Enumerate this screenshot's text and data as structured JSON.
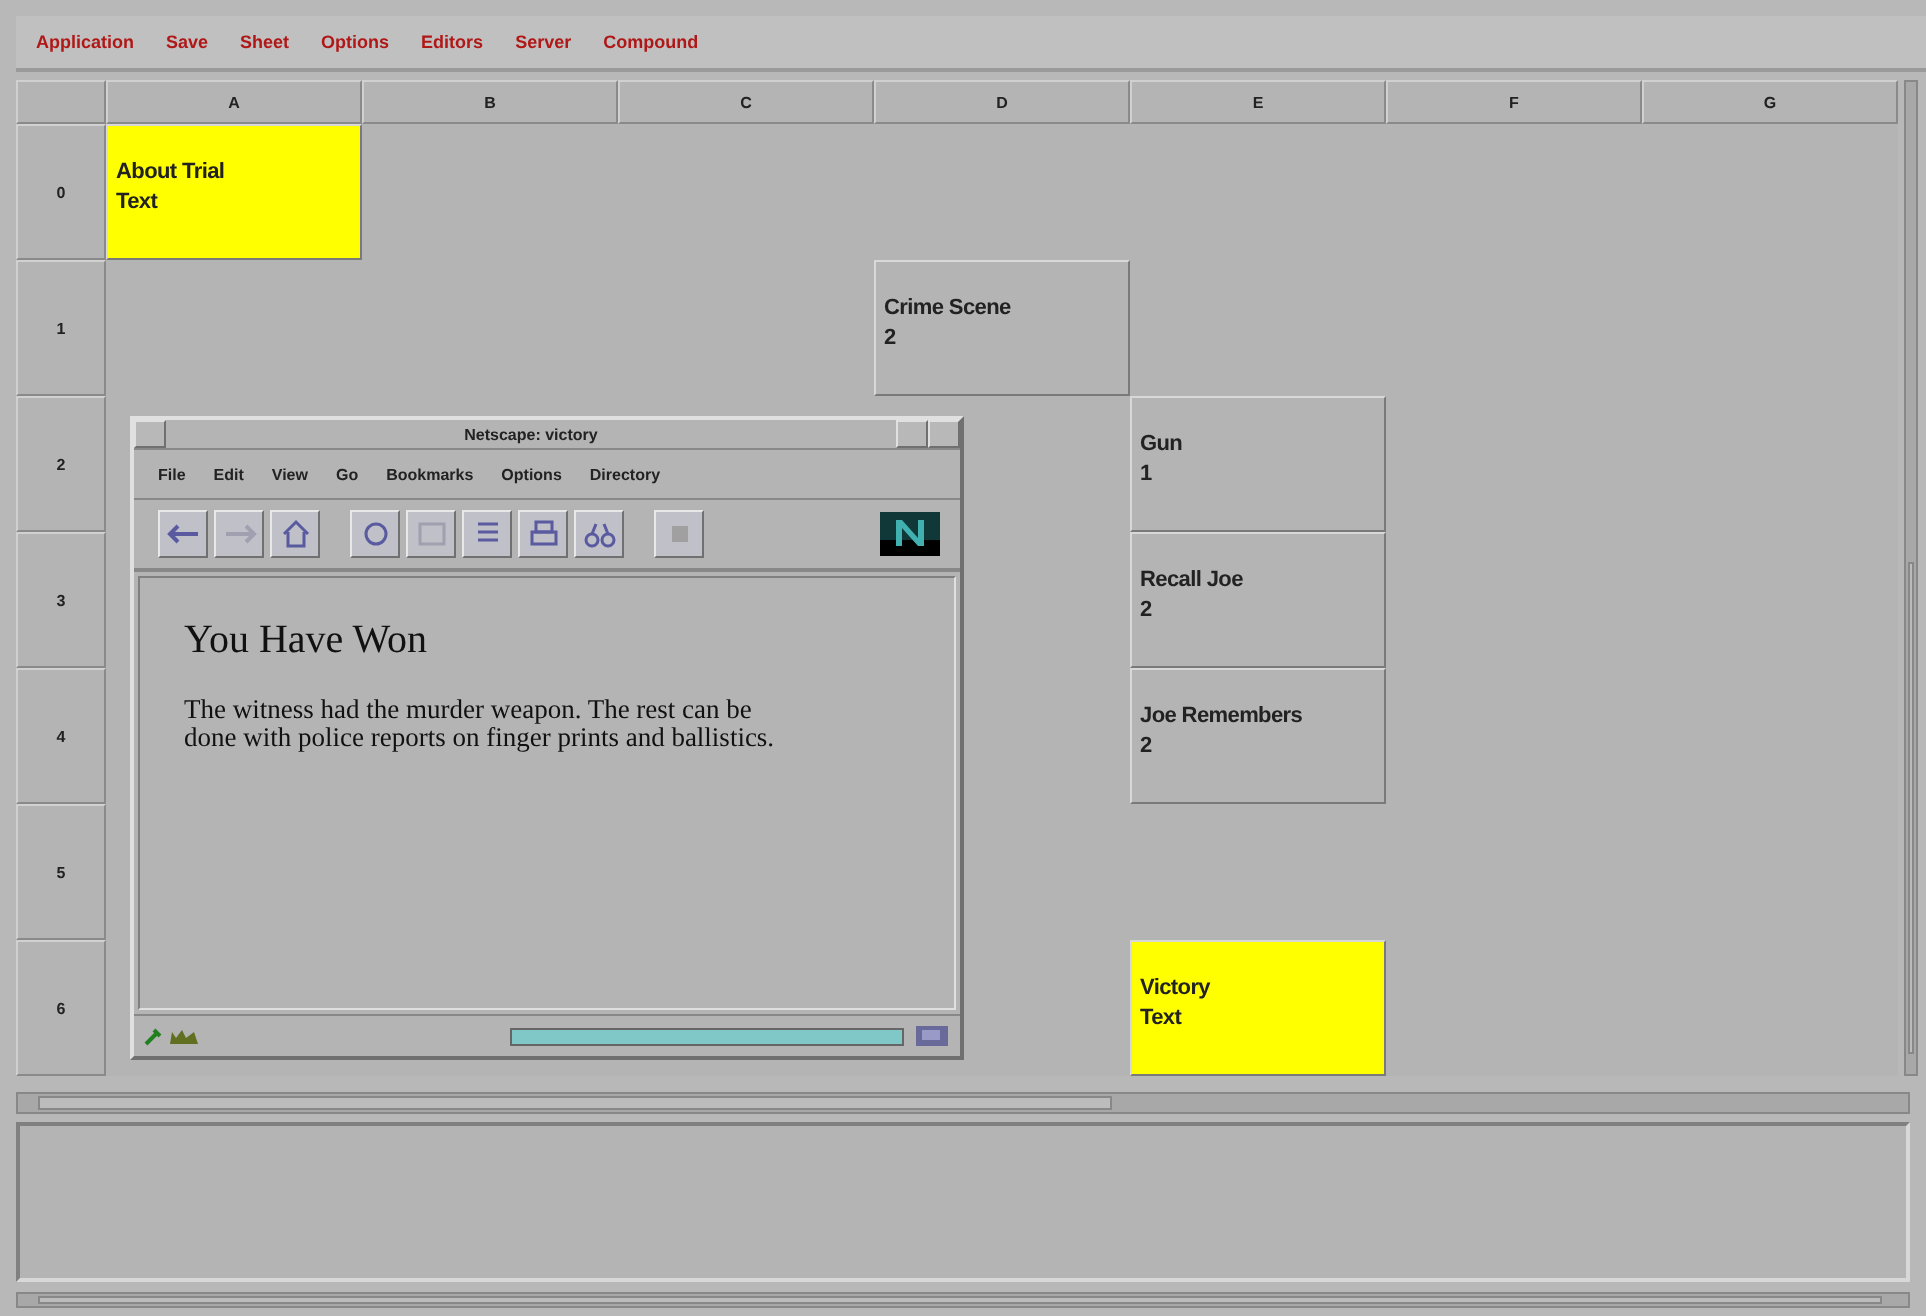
{
  "menu": [
    "Application",
    "Save",
    "Sheet",
    "Options",
    "Editors",
    "Server",
    "Compound"
  ],
  "sheet": {
    "columns": [
      "A",
      "B",
      "C",
      "D",
      "E",
      "F",
      "G"
    ],
    "rows": [
      {
        "header": "0",
        "cells": [
          {
            "text": "About Trial\nText",
            "color": "#ffff00"
          },
          null,
          null,
          null,
          null,
          null,
          null
        ]
      },
      {
        "header": "1",
        "cells": [
          null,
          null,
          null,
          {
            "text": "Crime Scene\n2",
            "color": "#b4b4b4"
          },
          null,
          null,
          null
        ]
      },
      {
        "header": "2",
        "cells": [
          null,
          null,
          null,
          null,
          {
            "text": "Gun\n1",
            "color": "#b4b4b4"
          },
          null,
          null
        ]
      },
      {
        "header": "3",
        "cells": [
          null,
          null,
          null,
          null,
          {
            "text": "Recall Joe\n2",
            "color": "#b4b4b4"
          },
          null,
          null
        ]
      },
      {
        "header": "4",
        "cells": [
          null,
          null,
          null,
          null,
          {
            "text": "Joe Remembers\n2",
            "color": "#b4b4b4"
          },
          null,
          null
        ]
      },
      {
        "header": "5",
        "cells": [
          null,
          null,
          null,
          null,
          null,
          null,
          null
        ]
      },
      {
        "header": "6",
        "cells": [
          null,
          null,
          null,
          null,
          {
            "text": "Victory\nText",
            "color": "#ffff00"
          },
          null,
          null
        ]
      }
    ]
  },
  "browser": {
    "title": "Netscape: victory",
    "menu": [
      "File",
      "Edit",
      "View",
      "Go",
      "Bookmarks",
      "Options",
      "Directory"
    ],
    "heading": "You Have Won",
    "body": "The witness had the murder weapon. The rest can be done with police reports on finger prints and ballistics.",
    "progress": {
      "level": 1
    }
  }
}
